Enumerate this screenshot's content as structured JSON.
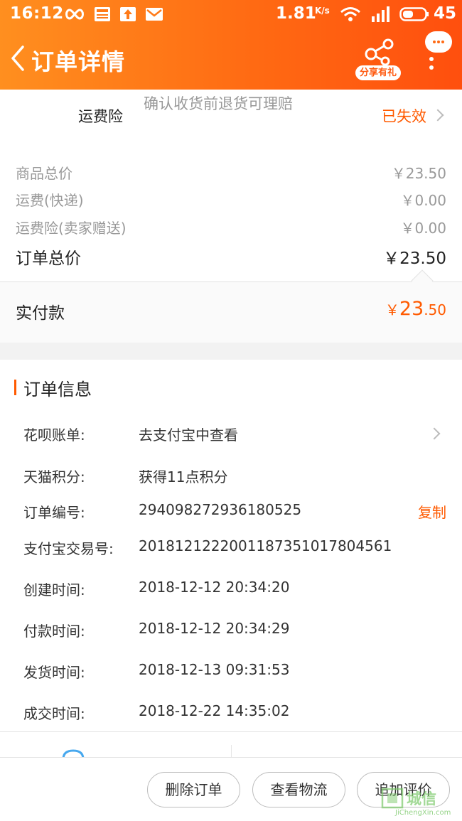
{
  "status_bar": {
    "time": "16:12",
    "speed": "1.81",
    "speed_unit": "K/s",
    "battery": "45"
  },
  "header": {
    "title": "订单详情",
    "share_badge": "分享有礼"
  },
  "insurance": {
    "title": "运费险",
    "description": "确认收货前退货可理赔",
    "status": "已失效"
  },
  "prices": {
    "rows": [
      {
        "label": "商品总价",
        "value": "￥23.50"
      },
      {
        "label": "运费(快递)",
        "value": "￥0.00"
      },
      {
        "label": "运费险(卖家赠送)",
        "value": "￥0.00"
      }
    ],
    "total_label": "订单总价",
    "total_value": "￥23.50"
  },
  "paid": {
    "label": "实付款",
    "symbol": "￥",
    "integer": "23",
    "decimal": ".50"
  },
  "order_info": {
    "title": "订单信息",
    "rows": [
      {
        "key": "花呗账单:",
        "value": "去支付宝中查看"
      },
      {
        "key": "天猫积分:",
        "value": "获得11点积分"
      },
      {
        "key": "订单编号:",
        "value": "294098272936180525",
        "action": "复制"
      },
      {
        "key": "支付宝交易号:",
        "value": "2018121222001187351017804561"
      },
      {
        "key": "创建时间:",
        "value": "2018-12-12 20:34:20"
      },
      {
        "key": "付款时间:",
        "value": "2018-12-12 20:34:29"
      },
      {
        "key": "发货时间:",
        "value": "2018-12-13 09:31:53"
      },
      {
        "key": "成交时间:",
        "value": "2018-12-22 14:35:02"
      }
    ]
  },
  "bottom_bar": {
    "delete_order": "删除订单",
    "view_logistics": "查看物流",
    "add_review": "追加评价"
  },
  "watermark": {
    "text": "城信",
    "site": "JiChengXin.com"
  },
  "colors": {
    "header_gradient_start": "#ff8f1f",
    "header_gradient_end": "#ff4f0e",
    "accent": "#ff5a00",
    "secondary_text": "#999999",
    "primary_text": "#222222"
  }
}
